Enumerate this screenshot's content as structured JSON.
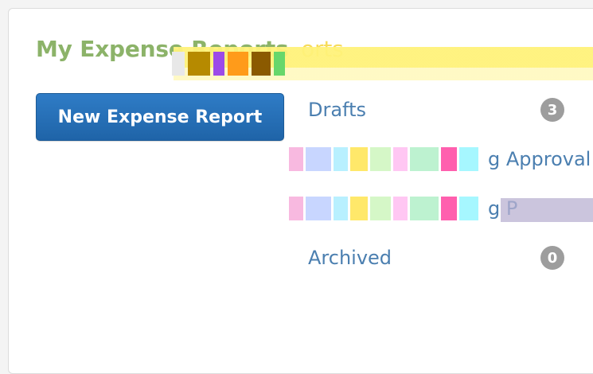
{
  "header": {
    "title": "My Expense Reports",
    "ghost_title": "orts"
  },
  "actions": {
    "new_report_label": "New Expense Report"
  },
  "menu": {
    "items": [
      {
        "label": "Drafts",
        "count": "3"
      },
      {
        "label": "g Approval",
        "count": ""
      },
      {
        "label": "g P",
        "count": ""
      },
      {
        "label": "Archived",
        "count": "0"
      }
    ]
  }
}
